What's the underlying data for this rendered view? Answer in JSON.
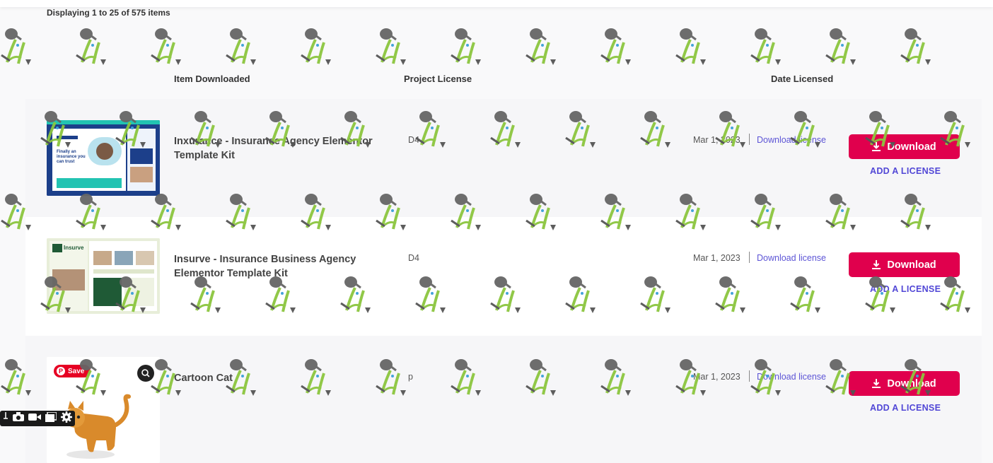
{
  "summary": {
    "count_text": "Displaying 1 to 25 of 575 items"
  },
  "columns": {
    "item": "Item Downloaded",
    "license": "Project License",
    "date": "Date Licensed"
  },
  "rows": [
    {
      "title": "Inxurance - Insurance Agency Elementor Template Kit",
      "license": "D4",
      "date": "Mar 1, 2023",
      "download_license": "Download license",
      "download_button": "Download",
      "add_license": "ADD A LICENSE",
      "thumb_text": [
        "Finally an",
        "insurance you",
        "can trust"
      ]
    },
    {
      "title": "Insurve - Insurance Business Agency Elementor Template Kit",
      "license": "D4",
      "date": "Mar 1, 2023",
      "download_license": "Download license",
      "download_button": "Download",
      "add_license": "ADD A LICENSE",
      "thumb_text": [
        "Insurve"
      ]
    },
    {
      "title": "Cartoon Cat",
      "license": "p",
      "date": "Mar 1, 2023",
      "download_license": "Download license",
      "download_button": "Download",
      "add_license": "ADD A LICENSE",
      "thumb_text": []
    }
  ],
  "overlays": {
    "pin_save": "Save"
  },
  "colors": {
    "accent_button": "#e0004d",
    "link": "#5d55d6",
    "add_license": "#5147d6"
  },
  "icons": [
    "download-icon",
    "watering-can-watermark",
    "pinterest-icon",
    "lens-icon",
    "camera-icon",
    "video-icon",
    "copy-icon",
    "gear-icon"
  ]
}
